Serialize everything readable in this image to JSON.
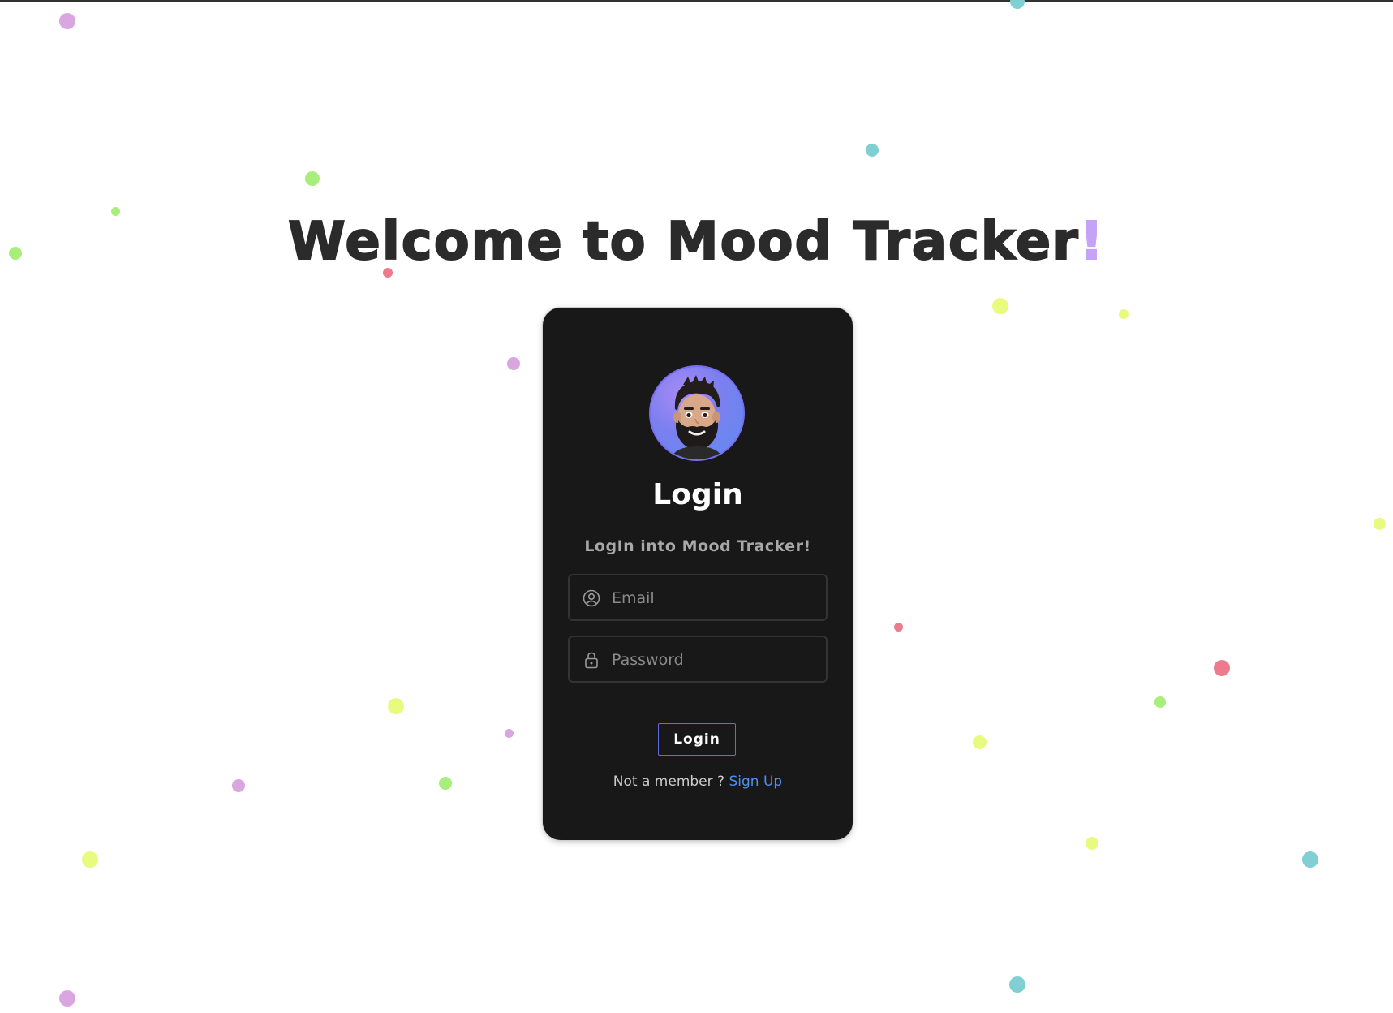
{
  "page": {
    "headline": "Welcome to Mood Tracker",
    "headline_accent": "!",
    "accent_color": "#c4a3f7"
  },
  "login_card": {
    "title": "Login",
    "subtitle": "LogIn into Mood Tracker!",
    "avatar_icon": "avatar-memoji-icon",
    "email": {
      "placeholder": "Email",
      "value": "",
      "icon": "user-circle-icon"
    },
    "password": {
      "placeholder": "Password",
      "value": "",
      "icon": "lock-icon"
    },
    "login_button_label": "Login",
    "signup_prompt": "Not a member ? ",
    "signup_link_label": "Sign Up",
    "link_color": "#4f8ff0"
  },
  "confetti_colors": [
    "#d9a6e0",
    "#7fcfd3",
    "#a7ee7a",
    "#e8fb7e",
    "#ee7a8e"
  ]
}
